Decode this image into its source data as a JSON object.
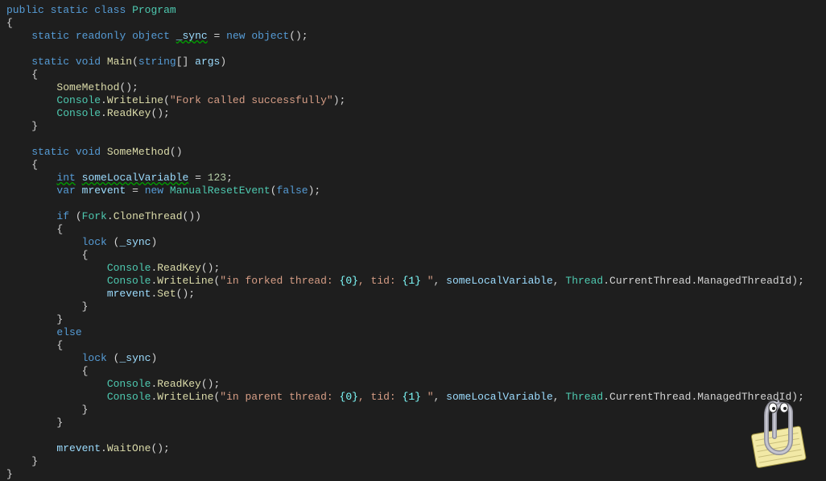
{
  "code": {
    "l1": {
      "kw_public": "public",
      "kw_static": "static",
      "kw_class": "class",
      "name": "Program"
    },
    "l2": {
      "brace": "{"
    },
    "l3": {
      "kw_static": "static",
      "kw_readonly": "readonly",
      "kw_object": "object",
      "field": "_sync",
      "eq": "=",
      "kw_new": "new",
      "kw_object2": "object",
      "paren": "();"
    },
    "l4": {
      "blank": ""
    },
    "l5": {
      "kw_static": "static",
      "kw_void": "void",
      "name": "Main",
      "p_open": "(",
      "kw_string": "string",
      "brackets": "[]",
      "arg": "args",
      "p_close": ")"
    },
    "l6": {
      "brace": "{"
    },
    "l7": {
      "call": "SomeMethod",
      "paren": "();"
    },
    "l8": {
      "cls": "Console",
      "dot": ".",
      "mth": "WriteLine",
      "p_open": "(",
      "str": "\"Fork called successfully\"",
      "p_close": ");"
    },
    "l9": {
      "cls": "Console",
      "dot": ".",
      "mth": "ReadKey",
      "paren": "();"
    },
    "l10": {
      "brace": "}"
    },
    "l11": {
      "blank": ""
    },
    "l12": {
      "kw_static": "static",
      "kw_void": "void",
      "name": "SomeMethod",
      "paren": "()"
    },
    "l13": {
      "brace": "{"
    },
    "l14": {
      "kw_int": "int",
      "var": "someLocalVariable",
      "eq": "=",
      "num": "123",
      "semi": ";"
    },
    "l15": {
      "kw_var": "var",
      "var": "mrevent",
      "eq": "=",
      "kw_new": "new",
      "cls": "ManualResetEvent",
      "p_open": "(",
      "kw_false": "false",
      "p_close": ");"
    },
    "l16": {
      "blank": ""
    },
    "l17": {
      "kw_if": "if",
      "p_open": "(",
      "cls": "Fork",
      "dot": ".",
      "mth": "CloneThread",
      "paren": "())"
    },
    "l18": {
      "brace": "{"
    },
    "l19": {
      "kw_lock": "lock",
      "p_open": "(",
      "var": "_sync",
      "p_close": ")"
    },
    "l20": {
      "brace": "{"
    },
    "l21": {
      "cls": "Console",
      "dot": ".",
      "mth": "ReadKey",
      "paren": "();"
    },
    "l22": {
      "cls": "Console",
      "dot": ".",
      "mth": "WriteLine",
      "p_open": "(",
      "str1": "\"in forked thread: ",
      "fmt1": "{0}",
      "str2": ", tid: ",
      "fmt2": "{1}",
      "str3": " \"",
      "comma": ", ",
      "var1": "someLocalVariable",
      "comma2": ", ",
      "cls2": "Thread",
      "dot2": ".",
      "prop": "CurrentThread",
      "dot3": ".",
      "prop2": "ManagedThreadId",
      "p_close": ");"
    },
    "l23": {
      "var": "mrevent",
      "dot": ".",
      "mth": "Set",
      "paren": "();"
    },
    "l24": {
      "brace": "}"
    },
    "l25": {
      "brace": "}"
    },
    "l26": {
      "kw_else": "else"
    },
    "l27": {
      "brace": "{"
    },
    "l28": {
      "kw_lock": "lock",
      "p_open": "(",
      "var": "_sync",
      "p_close": ")"
    },
    "l29": {
      "brace": "{"
    },
    "l30": {
      "cls": "Console",
      "dot": ".",
      "mth": "ReadKey",
      "paren": "();"
    },
    "l31": {
      "cls": "Console",
      "dot": ".",
      "mth": "WriteLine",
      "p_open": "(",
      "str1": "\"in parent thread: ",
      "fmt1": "{0}",
      "str2": ", tid: ",
      "fmt2": "{1}",
      "str3": " \"",
      "comma": ", ",
      "var1": "someLocalVariable",
      "comma2": ", ",
      "cls2": "Thread",
      "dot2": ".",
      "prop": "CurrentThread",
      "dot3": ".",
      "prop2": "ManagedThreadId",
      "p_close": ");"
    },
    "l32": {
      "brace": "}"
    },
    "l33": {
      "brace": "}"
    },
    "l34": {
      "blank": ""
    },
    "l35": {
      "var": "mrevent",
      "dot": ".",
      "mth": "WaitOne",
      "paren": "();"
    },
    "l36": {
      "brace": "}"
    },
    "l37": {
      "brace": "}"
    }
  },
  "assistant": {
    "name": "clippy-assistant"
  }
}
